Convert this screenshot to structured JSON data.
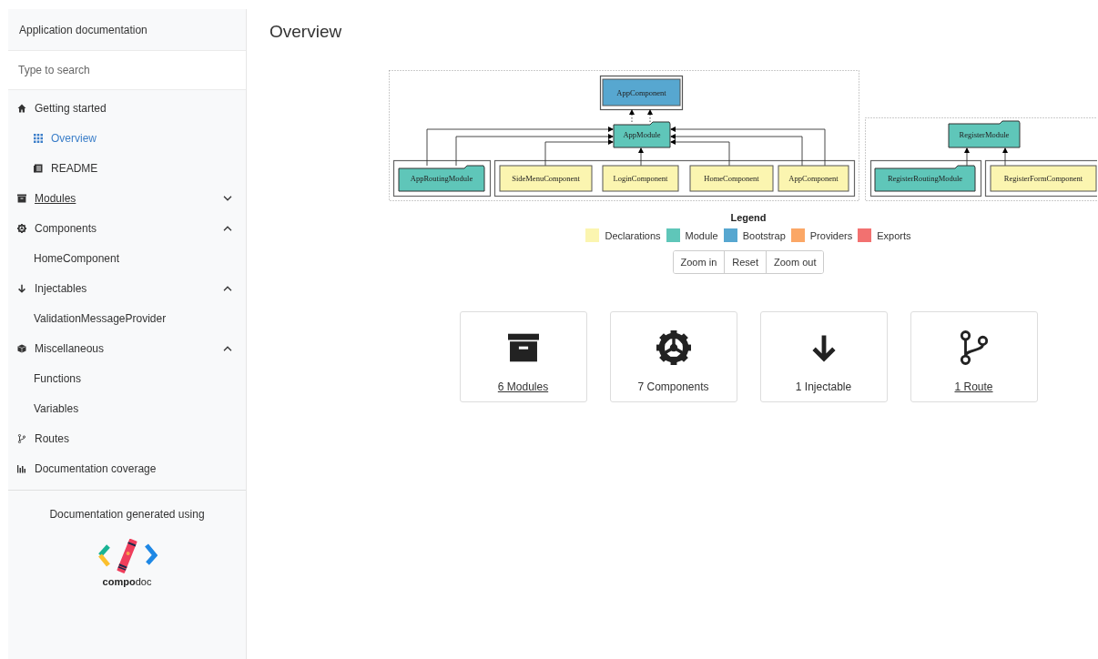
{
  "sidebar": {
    "title": "Application documentation",
    "search": {
      "placeholder": "Type to search"
    },
    "menu": [
      {
        "label": "Getting started",
        "children": [
          {
            "label": "Overview",
            "selected": true
          },
          {
            "label": "README",
            "selected": false
          }
        ]
      },
      {
        "label": "Modules",
        "link": true,
        "expanded": false
      },
      {
        "label": "Components",
        "link": false,
        "expanded": true,
        "children": [
          {
            "label": "HomeComponent",
            "selected": false
          }
        ]
      },
      {
        "label": "Injectables",
        "link": false,
        "expanded": true,
        "children": [
          {
            "label": "ValidationMessageProvider",
            "selected": false
          }
        ]
      },
      {
        "label": "Miscellaneous",
        "link": false,
        "expanded": true,
        "children": [
          {
            "label": "Functions",
            "selected": false
          },
          {
            "label": "Variables",
            "selected": false
          }
        ]
      },
      {
        "label": "Routes"
      },
      {
        "label": "Documentation coverage"
      }
    ],
    "footer": {
      "text": "Documentation generated using",
      "logo": "**compo**doc"
    }
  },
  "main": {
    "title": "Overview",
    "diagram": {
      "nodes": [
        {
          "label": "AppComponent",
          "kind": "bootstrap"
        },
        {
          "label": "AppModule",
          "kind": "module"
        },
        {
          "label": "AppRoutingModule",
          "kind": "module"
        },
        {
          "label": "SideMenuComponent",
          "kind": "declaration"
        },
        {
          "label": "LoginComponent",
          "kind": "declaration"
        },
        {
          "label": "HomeComponent",
          "kind": "declaration"
        },
        {
          "label": "AppComponent",
          "kind": "declaration"
        },
        {
          "label": "RegisterModule",
          "kind": "module"
        },
        {
          "label": "RegisterRoutingModule",
          "kind": "module"
        },
        {
          "label": "RegisterFormComponent",
          "kind": "declaration"
        }
      ]
    },
    "legend": {
      "title": "Legend",
      "items": [
        {
          "label": "Declarations",
          "color": "#fbf5b0"
        },
        {
          "label": "Module",
          "color": "#5fc6b9"
        },
        {
          "label": "Bootstrap",
          "color": "#57a7d0"
        },
        {
          "label": "Providers",
          "color": "#fba766"
        },
        {
          "label": "Exports",
          "color": "#f27170"
        }
      ]
    },
    "zoom_buttons": [
      "Zoom in",
      "Reset",
      "Zoom out"
    ],
    "cards": [
      {
        "label": "6 Modules",
        "link": true
      },
      {
        "label": "7 Components",
        "link": false
      },
      {
        "label": "1 Injectable",
        "link": false
      },
      {
        "label": "1 Route",
        "link": true
      }
    ]
  }
}
